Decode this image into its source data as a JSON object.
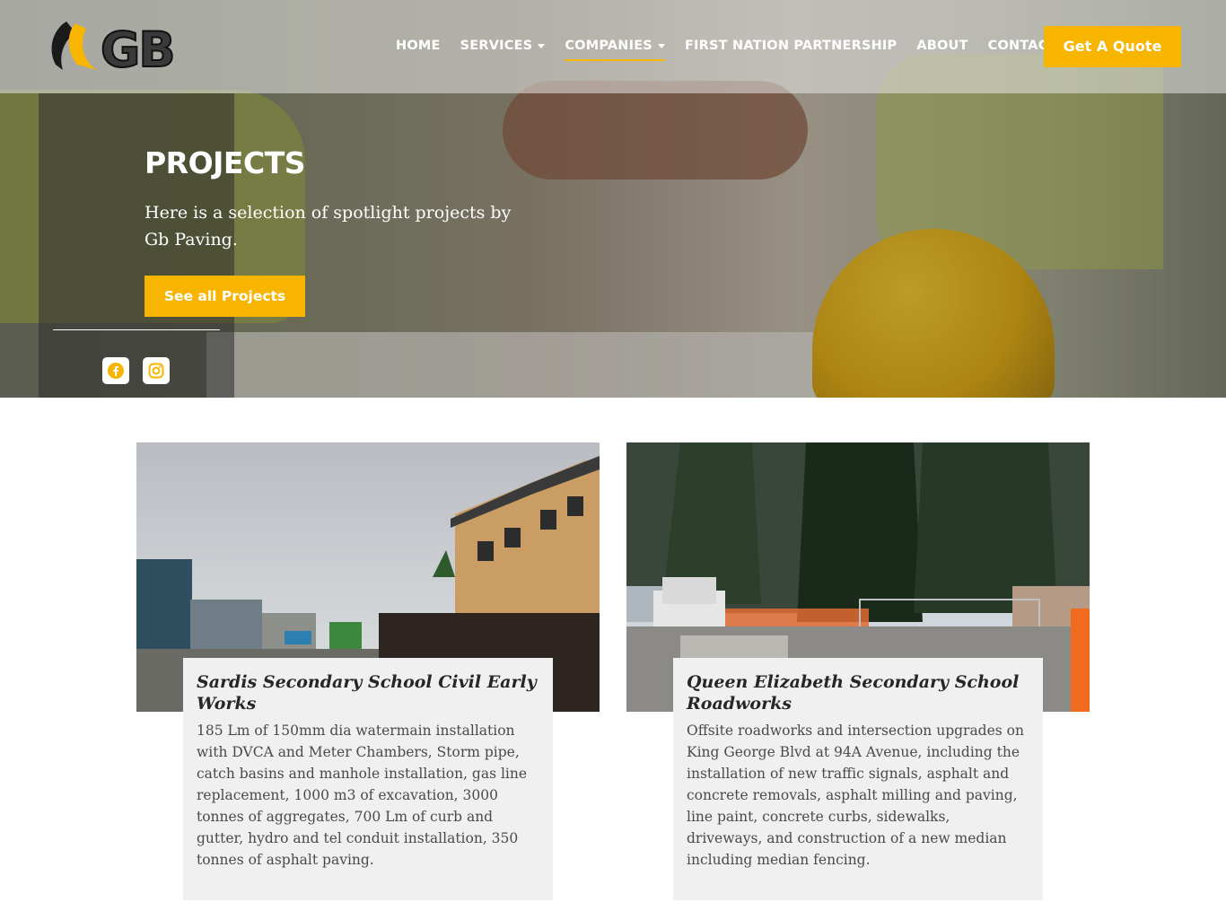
{
  "brand": {
    "logo_text": "GB",
    "accent": "#f7b500"
  },
  "nav": {
    "items": [
      {
        "label": "HOME",
        "dropdown": false,
        "active": false
      },
      {
        "label": "SERVICES",
        "dropdown": true,
        "active": false
      },
      {
        "label": "COMPANIES",
        "dropdown": true,
        "active": true
      },
      {
        "label": "FIRST NATION PARTNERSHIP",
        "dropdown": false,
        "active": false
      },
      {
        "label": "ABOUT",
        "dropdown": false,
        "active": false
      },
      {
        "label": "CONTACT",
        "dropdown": false,
        "active": false
      }
    ],
    "cta_label": "Get A Quote"
  },
  "hero": {
    "title": "PROJECTS",
    "subtitle": "Here is a selection of spotlight projects by Gb Paving.",
    "button_label": "See all Projects",
    "social": [
      "facebook-icon",
      "instagram-icon"
    ]
  },
  "projects": [
    {
      "title": "Sardis Secondary School Civil Early Works",
      "description": "185 Lm of 150mm dia watermain installation with DVCA and Meter Chambers, Storm pipe, catch basins and manhole installation, gas line replacement, 1000 m3 of excavation, 3000 tonnes of aggregates, 700 Lm of curb and gutter, hydro and tel conduit installation, 350 tonnes of asphalt paving."
    },
    {
      "title": "Queen Elizabeth Secondary School Roadworks",
      "description": "Offsite roadworks and intersection upgrades on King George Blvd at 94A Avenue, including the installation of new traffic signals, asphalt and concrete removals, asphalt milling and paving, line paint, concrete curbs, sidewalks, driveways, and construction of a new median including median fencing."
    }
  ]
}
